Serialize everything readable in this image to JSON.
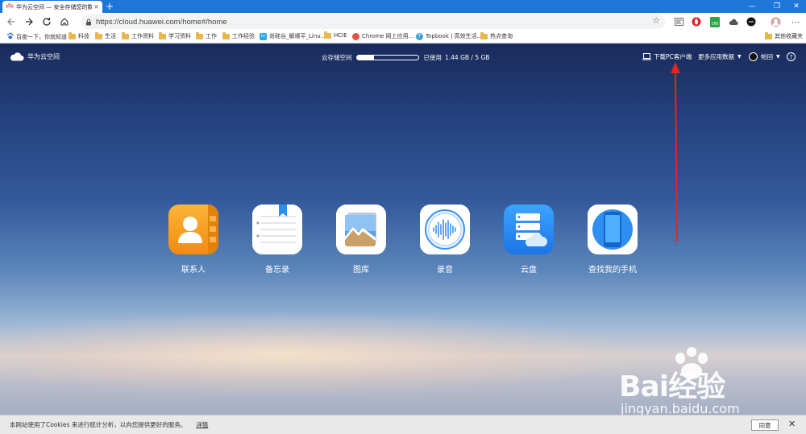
{
  "browser": {
    "tab_title": "华为云空间 — 安全存储您的数据",
    "tab_close": "×",
    "new_tab": "+",
    "url": "https://cloud.huawei.com/home#/home",
    "win_min": "—",
    "win_max": "❐",
    "win_close": "✕",
    "more_menu": "⋯"
  },
  "bookmarks": [
    {
      "label": "百度一下，你就知道",
      "icon": "paw-icon"
    },
    {
      "label": "科技",
      "icon": "folder-icon"
    },
    {
      "label": "生活",
      "icon": "folder-icon"
    },
    {
      "label": "工作资料",
      "icon": "folder-icon"
    },
    {
      "label": "学习资料",
      "icon": "folder-icon"
    },
    {
      "label": "工作",
      "icon": "folder-icon"
    },
    {
      "label": "工作经验",
      "icon": "folder-icon"
    },
    {
      "label": "尚硅谷_解顺平_Linu...",
      "icon": "bilibili-icon"
    },
    {
      "label": "HCIE",
      "icon": "folder-icon"
    },
    {
      "label": "Chrome 网上应用...",
      "icon": "chrome-store-icon"
    },
    {
      "label": "Topbook | 高效生活...",
      "icon": "topbook-icon"
    },
    {
      "label": "热点查询",
      "icon": "folder-icon"
    },
    {
      "label": "其他收藏夹",
      "icon": "folder-icon"
    }
  ],
  "header": {
    "brand": "华为云空间",
    "storage_label": "云存储空间",
    "storage_used_label": "已使用",
    "storage_amount": "1.44 GB / 5 GB",
    "storage_fraction": 0.288,
    "download_pc": "下载PC客户端",
    "more_data": "更多应用数据",
    "user": "帕回",
    "help": "?"
  },
  "apps": [
    {
      "label": "联系人",
      "icon": "contacts-icon"
    },
    {
      "label": "备忘录",
      "icon": "notepad-icon"
    },
    {
      "label": "图库",
      "icon": "gallery-icon"
    },
    {
      "label": "录音",
      "icon": "recorder-icon"
    },
    {
      "label": "云盘",
      "icon": "cloud-drive-icon"
    },
    {
      "label": "查找我的手机",
      "icon": "find-phone-icon"
    }
  ],
  "watermark": {
    "brand": "Bai经验",
    "url": "jingyan.baidu.com"
  },
  "cookie": {
    "text": "本网站使用了Cookies 来进行统计分析，以向您提供更好的服务。",
    "details": "详情",
    "agree": "同意",
    "close": "✕"
  },
  "colors": {
    "titlebar": "#1f75d8",
    "annotation_arrow": "#e8231f",
    "contacts_tile": "#f7a11b",
    "cloud_drive_tile": "#2f8ff0"
  }
}
